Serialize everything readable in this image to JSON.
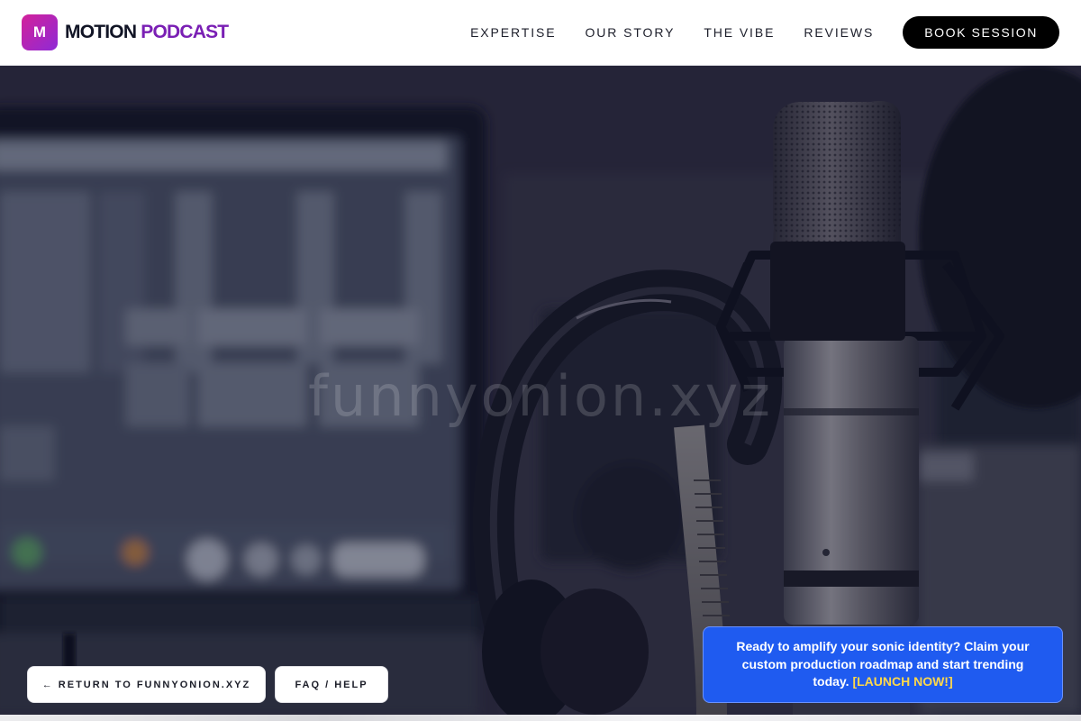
{
  "header": {
    "logo_letter": "M",
    "brand_part1": "MOTION",
    "brand_part2": "PODCAST",
    "nav": [
      "EXPERTISE",
      "OUR STORY",
      "THE VIBE",
      "REVIEWS"
    ],
    "cta_label": "BOOK SESSION"
  },
  "hero": {
    "watermark": "funnyonion.xyz"
  },
  "footer_buttons": {
    "return_label": "← RETURN TO FUNNYONION.XYZ",
    "faq_label": "FAQ / HELP"
  },
  "cta_box": {
    "text": "Ready to amplify your sonic identity? Claim your custom production roadmap and start trending today. ",
    "link_label": "[LAUNCH NOW!]"
  },
  "colors": {
    "brand_accent": "#7a1fb4",
    "logo_gradient_start": "#d3219a",
    "logo_gradient_end": "#8e2ad6",
    "cta_background": "#1f5bf0",
    "cta_link": "#ffd84a"
  }
}
